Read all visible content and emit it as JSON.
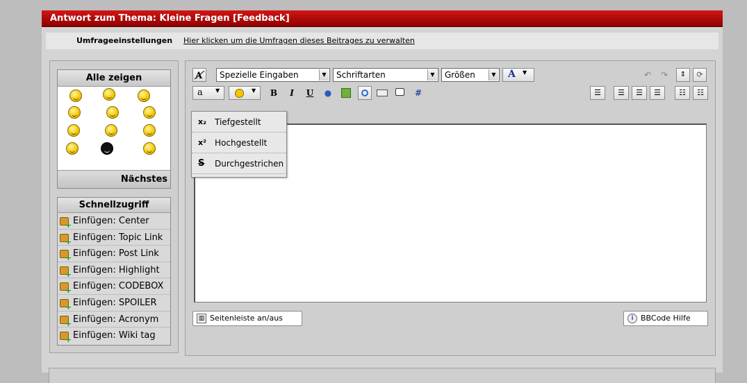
{
  "header": {
    "title": "Antwort zum Thema: Kleine Fragen [Feedback]"
  },
  "poll": {
    "label": "Umfrageeinstellungen",
    "link": "Hier klicken um die Umfragen dieses Beitrages zu verwalten"
  },
  "smilies": {
    "title": "Alle zeigen",
    "next": "Nächstes"
  },
  "quick": {
    "title": "Schnellzugriff",
    "items": [
      "Einfügen: Center",
      "Einfügen: Topic Link",
      "Einfügen: Post Link",
      "Einfügen: Highlight",
      "Einfügen: CODEBOX",
      "Einfügen: SPOILER",
      "Einfügen: Acronym",
      "Einfügen: Wiki tag"
    ]
  },
  "toolbar": {
    "special": "Spezielle Eingaben",
    "fonts": "Schriftarten",
    "sizes": "Größen",
    "color_label": "A",
    "bold": "B",
    "italic": "I",
    "underline": "U",
    "hash": "#"
  },
  "dropdown": {
    "items": [
      {
        "icon": "x₂",
        "label": "Tiefgestellt"
      },
      {
        "icon": "x²",
        "label": "Hochgestellt"
      },
      {
        "icon": "S",
        "label": "Durchgestrichen"
      }
    ]
  },
  "buttons": {
    "sidebar_toggle": "Seitenleiste an/aus",
    "bbcode_help": "BBCode Hilfe"
  },
  "colors": {
    "title_bar": "#b00000",
    "background": "#bdbdbd"
  }
}
